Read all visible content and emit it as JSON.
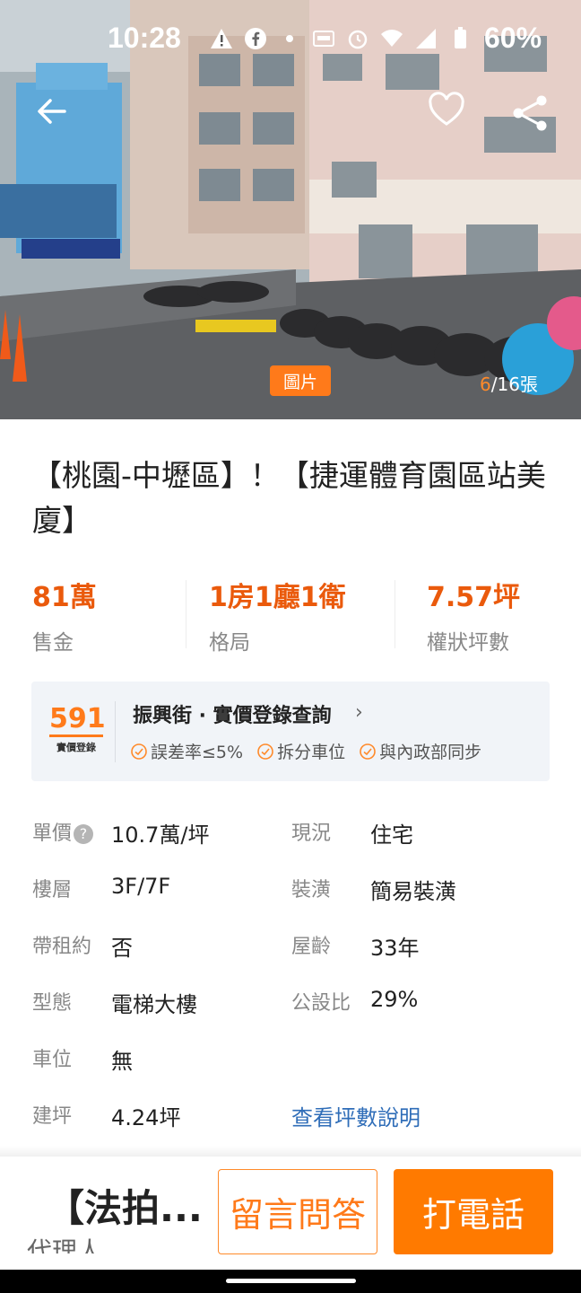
{
  "status_bar": {
    "time": "10:28",
    "battery": "60%",
    "icons": [
      "warning-icon",
      "facebook-icon",
      "dot-icon",
      "auto-brightness-icon",
      "alarm-icon",
      "wifi-icon",
      "signal-icon",
      "battery-icon"
    ]
  },
  "hero": {
    "photo_tag": "圖片",
    "photo_current": "6",
    "photo_total": "/16張",
    "actions": [
      "back-arrow-icon",
      "heart-icon",
      "share-icon"
    ]
  },
  "listing": {
    "title": "【桃園-中壢區】！【捷運體育園區站美廈】"
  },
  "stats": [
    {
      "value": "81萬",
      "label": "售金"
    },
    {
      "value": "1房1廳1衛",
      "label": "格局"
    },
    {
      "value": "7.57坪",
      "label": "權狀坪數"
    }
  ],
  "price_panel": {
    "logo_number": "591",
    "logo_sub": "實價登錄",
    "title": "振興街 · 實價登錄查詢",
    "badges": [
      "誤差率≤5%",
      "拆分車位",
      "與內政部同步"
    ]
  },
  "details": {
    "unit_price_label": "單價",
    "unit_price": "10.7萬/坪",
    "status_label": "現況",
    "status": "住宅",
    "floor_label": "樓層",
    "floor": "3F/7F",
    "decor_label": "裝潢",
    "decor": "簡易裝潢",
    "lease_label": "帶租約",
    "lease": "否",
    "age_label": "屋齡",
    "age": "33年",
    "type_label": "型態",
    "type": "電梯大樓",
    "public_ratio_label": "公設比",
    "public_ratio": "29%",
    "parking_label": "車位",
    "parking": "無",
    "building_area_label": "建坪",
    "building_area": "4.24坪",
    "area_link": "查看坪數說明"
  },
  "bottom_bar": {
    "agent_name": "【法拍...",
    "agent_role": "代理人",
    "message_button": "留言問答",
    "call_button": "打電話"
  },
  "colors": {
    "accent": "#ea5a0c",
    "button_orange": "#ff7a00",
    "link_blue": "#2f6db8"
  }
}
